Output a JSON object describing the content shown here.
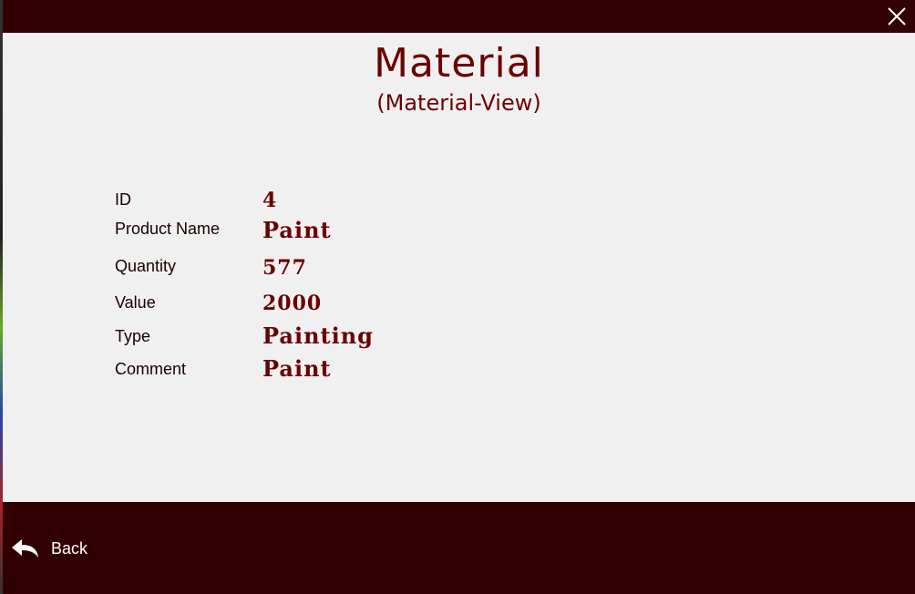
{
  "window": {
    "close_icon": "close-icon"
  },
  "header": {
    "title": "Material",
    "subtitle": "(Material-View)"
  },
  "fields": [
    {
      "label": "ID",
      "value": "4"
    },
    {
      "label": "Product Name",
      "value": "Paint"
    },
    {
      "label": "Quantity",
      "value": "577"
    },
    {
      "label": "Value",
      "value": "2000"
    },
    {
      "label": "Type",
      "value": "Painting"
    },
    {
      "label": "Comment",
      "value": "Paint"
    }
  ],
  "footer": {
    "back_label": "Back",
    "back_icon": "reply-arrow-icon"
  },
  "colors": {
    "bar": "#310000",
    "accent": "#6b0000",
    "background": "#f0f0f0"
  }
}
